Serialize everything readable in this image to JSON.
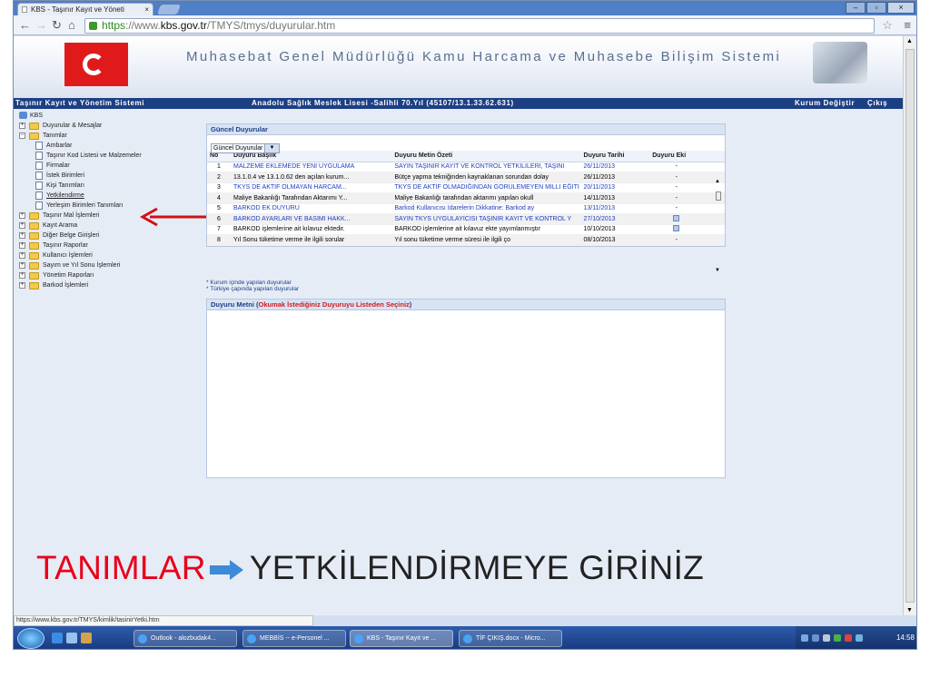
{
  "browser": {
    "tab_title": "KBS - Taşınır Kayıt ve Yöneti",
    "tab_close": "×",
    "url_scheme": "https",
    "url_rest_pre": "://www.",
    "url_domain": "kbs.gov.tr",
    "url_path": "/TMYS/tmys/duyurular.htm",
    "status_url": "https://www.kbs.gov.tr/TMYS/kimlik/tasinirYetki.htm"
  },
  "header": {
    "title": "Muhasebat Genel Müdürlüğü Kamu Harcama ve Muhasebe Bilişim Sistemi",
    "system_name": "Taşınır Kayıt ve Yönetim Sistemi",
    "institution": "Anadolu Sağlık Meslek Lisesi -Salihli 70.Yıl (45107/13.1.33.62.631)",
    "change_institution": "Kurum Değiştir",
    "logout": "Çıkış"
  },
  "tree": {
    "root": "KBS",
    "items": [
      {
        "label": "Duyurular & Mesajlar",
        "level": 0,
        "kind": "folder",
        "sign": "+"
      },
      {
        "label": "Tanımlar",
        "level": 0,
        "kind": "folder",
        "sign": "−"
      },
      {
        "label": "Ambarlar",
        "level": 1,
        "kind": "doc"
      },
      {
        "label": "Taşınır Kod Listesi ve Malzemeler",
        "level": 1,
        "kind": "doc"
      },
      {
        "label": "Firmalar",
        "level": 1,
        "kind": "doc"
      },
      {
        "label": "İstek Birimleri",
        "level": 1,
        "kind": "doc"
      },
      {
        "label": "Kişi Tanımları",
        "level": 1,
        "kind": "doc"
      },
      {
        "label": "Yetkilendirme",
        "level": 1,
        "kind": "doc",
        "underline": true
      },
      {
        "label": "Yerleşim Birimleri Tanımları",
        "level": 1,
        "kind": "doc"
      },
      {
        "label": "Taşınır Mal İşlemleri",
        "level": 0,
        "kind": "folder",
        "sign": "+"
      },
      {
        "label": "Kayıt Arama",
        "level": 0,
        "kind": "folder",
        "sign": "+"
      },
      {
        "label": "Diğer Belge Girişleri",
        "level": 0,
        "kind": "folder",
        "sign": "+"
      },
      {
        "label": "Taşınır Raporlar",
        "level": 0,
        "kind": "folder",
        "sign": "+"
      },
      {
        "label": "Kullanıcı İşlemleri",
        "level": 0,
        "kind": "folder",
        "sign": "+"
      },
      {
        "label": "Sayım ve Yıl Sonu İşlemleri",
        "level": 0,
        "kind": "folder",
        "sign": "+"
      },
      {
        "label": "Yönetim Raporları",
        "level": 0,
        "kind": "folder",
        "sign": "+"
      },
      {
        "label": "Barkod İşlemleri",
        "level": 0,
        "kind": "folder",
        "sign": "+"
      }
    ]
  },
  "announcements": {
    "panel_title": "Güncel Duyurular",
    "filter_value": "Güncel Duyurular",
    "columns": [
      "No",
      "Duyuru Başlık",
      "Duyuru Metin Özeti",
      "Duyuru Tarihi",
      "Duyuru Eki"
    ],
    "rows": [
      {
        "no": "1",
        "title": "MALZEME EKLEMEDE YENİ UYGULAMA",
        "summary": "SAYIN TAŞINIR KAYIT VE KONTROL YETKİLİLERİ, TAŞINI",
        "date": "26/11/2013",
        "attach": "-",
        "blue": true
      },
      {
        "no": "2",
        "title": "13.1.0.4 ve 13.1.0.62 den açılan kurum...",
        "summary": "Bütçe yapma tekniğinden kaynaklanan sorundan dolay",
        "date": "26/11/2013",
        "attach": "-",
        "blue": false
      },
      {
        "no": "3",
        "title": "TKYS DE AKTİF OLMAYAN HARCAM...",
        "summary": "TKYS DE AKTİF OLMADIĞINDAN GÖRÜLEMEYEN MİLLİ EĞİTİ",
        "date": "20/11/2013",
        "attach": "-",
        "blue": true
      },
      {
        "no": "4",
        "title": "Maliye Bakanlığı Tarafından Aktarımı Y...",
        "summary": "Maliye Bakanlığı tarafından aktarımı yapılan okull",
        "date": "14/11/2013",
        "attach": "-",
        "blue": false
      },
      {
        "no": "5",
        "title": "BARKOD EK DUYURU",
        "summary": "Barkod Kullanıcısı İdarelerin Dikkatine: Barkod ay",
        "date": "13/11/2013",
        "attach": "-",
        "blue": true
      },
      {
        "no": "6",
        "title": "BARKOD AYARLARI VE BASIMI HAKK...",
        "summary": "SAYIN TKYS UYGULAYICISI TAŞINIR KAYIT VE KONTROL Y",
        "date": "27/10/2013",
        "attach": "icon",
        "blue": true
      },
      {
        "no": "7",
        "title": "BARKOD işlemlerine ait kılavuz ektedir.",
        "summary": "BARKOD işlemlerine ait kılavuz ekte yayımlanmıştır",
        "date": "10/10/2013",
        "attach": "icon",
        "blue": false
      },
      {
        "no": "8",
        "title": "Yıl Sonu tüketime verme ile ilgili sorular",
        "summary": "Yıl sonu tüketime verme süresi ile ilgili ço",
        "date": "08/10/2013",
        "attach": "-",
        "blue": false
      }
    ],
    "note1": "* Kurum içinde yapılan duyurular",
    "note2": "* Türkiye çapında yapılan duyurular"
  },
  "text_panel": {
    "title_prefix": "Duyuru Metni (",
    "title_hint": "Okumak İstediğiniz Duyuruyu Listeden Seçiniz",
    "title_suffix": ")"
  },
  "taskbar": {
    "items": [
      "Outlook - alozbudak4...",
      "MEBBİS -- e-Personel ...",
      "KBS - Taşınır Kayıt ve ...",
      "TİF ÇIKIŞ.docx - Micro..."
    ],
    "clock": "14:58"
  },
  "caption": {
    "left": "TANIMLAR",
    "right": "YETKİLENDİRMEYE GİRİNİZ"
  },
  "colors": {
    "caption_red": "#e8001a",
    "arrow_red": "#d0101a",
    "arrow_blue": "#3d8ad6",
    "header_blue": "#1c3f84"
  }
}
